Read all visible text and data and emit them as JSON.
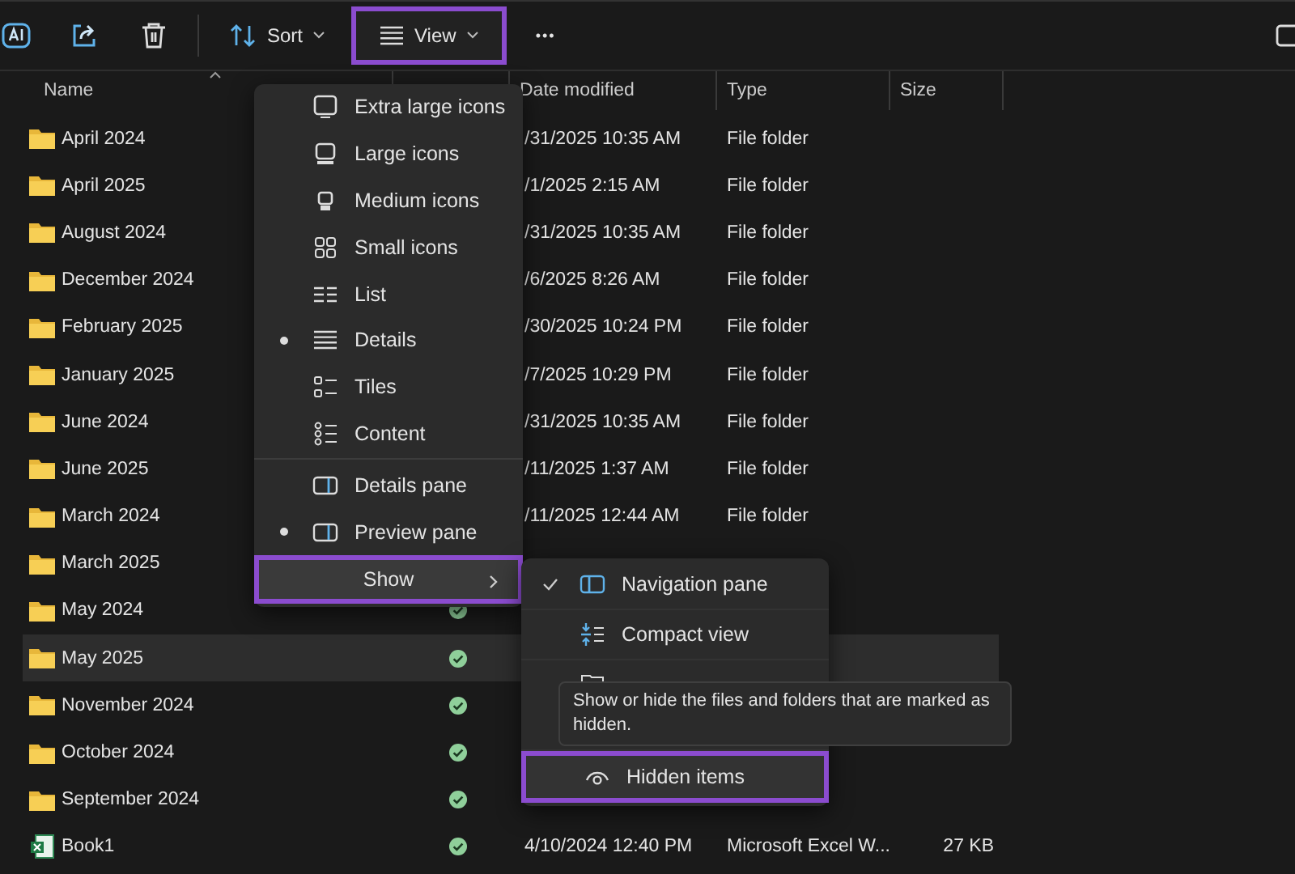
{
  "toolbar": {
    "sort_label": "Sort",
    "view_label": "View",
    "view_highlighted": true,
    "more_label": "•••"
  },
  "columns": {
    "name": "Name",
    "date": "Date modified",
    "type": "Type",
    "size": "Size"
  },
  "rows": [
    {
      "name": "April 2024",
      "kind": "folder",
      "date": "/31/2025 10:35 AM",
      "type": "File folder",
      "selected": false
    },
    {
      "name": "April 2025",
      "kind": "folder",
      "date": "/1/2025 2:15 AM",
      "type": "File folder",
      "selected": false
    },
    {
      "name": "August 2024",
      "kind": "folder",
      "date": "/31/2025 10:35 AM",
      "type": "File folder",
      "selected": false
    },
    {
      "name": "December 2024",
      "kind": "folder",
      "date": "/6/2025 8:26 AM",
      "type": "File folder",
      "selected": false
    },
    {
      "name": "February 2025",
      "kind": "folder",
      "date": "/30/2025 10:24 PM",
      "type": "File folder",
      "selected": false
    },
    {
      "name": "January 2025",
      "kind": "folder",
      "date": "/7/2025 10:29 PM",
      "type": "File folder",
      "selected": false
    },
    {
      "name": "June 2024",
      "kind": "folder",
      "date": "/31/2025 10:35 AM",
      "type": "File folder",
      "selected": false
    },
    {
      "name": "June 2025",
      "kind": "folder",
      "date": "/11/2025 1:37 AM",
      "type": "File folder",
      "selected": false
    },
    {
      "name": "March 2024",
      "kind": "folder",
      "date": "/11/2025 12:44 AM",
      "type": "File folder",
      "selected": false
    },
    {
      "name": "March 2025",
      "kind": "folder",
      "selected": false
    },
    {
      "name": "May 2024",
      "kind": "folder",
      "synced": true,
      "selected": false
    },
    {
      "name": "May 2025",
      "kind": "folder",
      "synced": true,
      "selected": true
    },
    {
      "name": "November 2024",
      "kind": "folder",
      "synced": true,
      "selected": false
    },
    {
      "name": "October 2024",
      "kind": "folder",
      "synced": true,
      "selected": false
    },
    {
      "name": "September 2024",
      "kind": "folder",
      "synced": true,
      "selected": false
    },
    {
      "name": "Book1",
      "kind": "excel",
      "date": "4/10/2024 12:40 PM",
      "type": "Microsoft Excel W...",
      "size": "27 KB",
      "synced": true,
      "selected": false
    }
  ],
  "view_menu": {
    "sections": [
      [
        {
          "label": "Extra large icons",
          "kind": "xl",
          "selected": false
        },
        {
          "label": "Large icons",
          "kind": "large",
          "selected": false
        },
        {
          "label": "Medium icons",
          "kind": "medium",
          "selected": false
        },
        {
          "label": "Small icons",
          "kind": "small",
          "selected": false
        },
        {
          "label": "List",
          "kind": "list",
          "selected": false
        },
        {
          "label": "Details",
          "kind": "details",
          "selected": true
        },
        {
          "label": "Tiles",
          "kind": "tiles",
          "selected": false
        },
        {
          "label": "Content",
          "kind": "content",
          "selected": false
        }
      ],
      [
        {
          "label": "Details pane",
          "kind": "pane",
          "selected": false
        },
        {
          "label": "Preview pane",
          "kind": "pane",
          "selected": true
        }
      ]
    ],
    "show": {
      "label": "Show",
      "highlighted": true
    }
  },
  "show_menu": {
    "items": [
      {
        "label": "Navigation pane",
        "kind": "pane",
        "checked": true,
        "highlighted": false
      },
      {
        "label": "Compact view",
        "kind": "compact",
        "checked": false,
        "highlighted": false
      },
      {
        "kind": "checkboxes"
      },
      {
        "label": "Hidden items",
        "kind": "eye",
        "checked": false,
        "highlighted": true
      }
    ]
  },
  "tooltip": "Show or hide the files and folders that are marked as hidden."
}
